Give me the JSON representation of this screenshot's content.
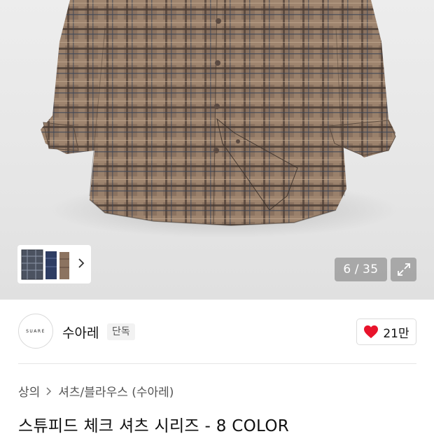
{
  "gallery": {
    "current_index": "6",
    "total": "35",
    "separator": "/",
    "expand_icon": "expand-icon",
    "thumb_chevron_icon": "chevron-right-icon"
  },
  "seller": {
    "logo_text": "SUARE",
    "name": "수아레",
    "badge": "단독",
    "like_icon": "heart-icon",
    "like_count": "21만",
    "accent_color": "#e8132b"
  },
  "breadcrumb": {
    "level1": "상의",
    "level2": "셔츠/블라우스 (수아레)",
    "separator_icon": "chevron-right-icon"
  },
  "product": {
    "title": "스튜피드 체크 셔츠 시리즈 - 8 COLOR"
  }
}
